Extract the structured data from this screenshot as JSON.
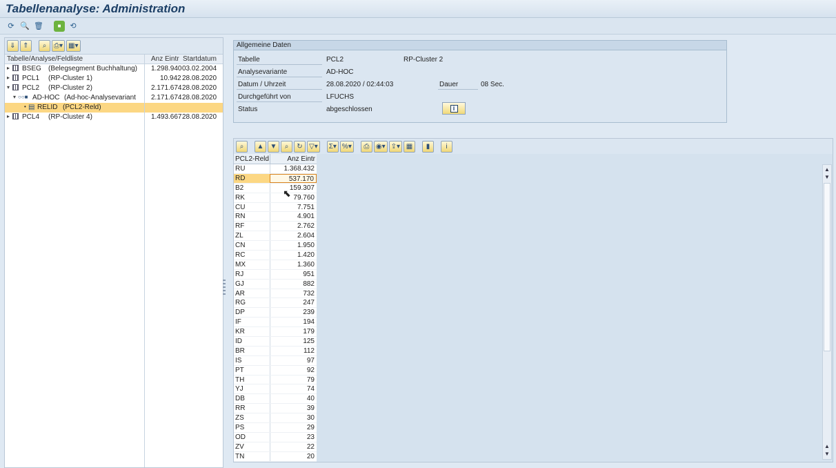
{
  "window": {
    "title": "Tabellenanalyse: Administration"
  },
  "toolbar": {
    "icons": [
      "execute-icon",
      "find-icon",
      "delete-icon",
      "new-icon",
      "refresh-icon"
    ]
  },
  "tree": {
    "columns": {
      "name": "Tabelle/Analyse/Feldliste",
      "count": "Anz Eintr",
      "date": "Startdatum"
    },
    "rows": [
      {
        "name": "BSEG",
        "desc": "(Belegsegment Buchhaltung)",
        "count": "1.298.940",
        "date": "03.02.2004"
      },
      {
        "name": "PCL1",
        "desc": "(RP-Cluster 1)",
        "count": "10.942",
        "date": "28.08.2020"
      },
      {
        "name": "PCL2",
        "desc": "(RP-Cluster 2)",
        "count": "2.171.674",
        "date": "28.08.2020"
      },
      {
        "name": "AD-HOC",
        "desc": "(Ad-hoc-Analysevariant",
        "count": "2.171.674",
        "date": "28.08.2020"
      },
      {
        "name": "RELID",
        "desc": "(PCL2-Reld)",
        "count": "",
        "date": ""
      },
      {
        "name": "PCL4",
        "desc": "(RP-Cluster 4)",
        "count": "1.493.667",
        "date": "28.08.2020"
      }
    ]
  },
  "general": {
    "header": "Allgemeine Daten",
    "tabelle_label": "Tabelle",
    "tabelle_value": "PCL2",
    "tabelle_desc": "RP-Cluster 2",
    "variante_label": "Analysevariante",
    "variante_value": "AD-HOC",
    "datum_label": "Datum / Uhrzeit",
    "datum_value": "28.08.2020 / 02:44:03",
    "dauer_label": "Dauer",
    "dauer_value": "08 Sec.",
    "durch_label": "Durchgeführt von",
    "durch_value": "LFUCHS",
    "status_label": "Status",
    "status_value": "abgeschlossen",
    "info_label": "i"
  },
  "grid": {
    "col_key": "PCL2-Reld",
    "col_count": "Anz Eintr",
    "rows": [
      [
        "RU",
        "1.368.432"
      ],
      [
        "RD",
        "537.170"
      ],
      [
        "B2",
        "159.307"
      ],
      [
        "RK",
        "79.760"
      ],
      [
        "CU",
        "7.751"
      ],
      [
        "RN",
        "4.901"
      ],
      [
        "RF",
        "2.762"
      ],
      [
        "ZL",
        "2.604"
      ],
      [
        "CN",
        "1.950"
      ],
      [
        "RC",
        "1.420"
      ],
      [
        "MX",
        "1.360"
      ],
      [
        "RJ",
        "951"
      ],
      [
        "GJ",
        "882"
      ],
      [
        "AR",
        "732"
      ],
      [
        "RG",
        "247"
      ],
      [
        "DP",
        "239"
      ],
      [
        "IF",
        "194"
      ],
      [
        "KR",
        "179"
      ],
      [
        "ID",
        "125"
      ],
      [
        "BR",
        "112"
      ],
      [
        "IS",
        "97"
      ],
      [
        "PT",
        "92"
      ],
      [
        "TH",
        "79"
      ],
      [
        "YJ",
        "74"
      ],
      [
        "DB",
        "40"
      ],
      [
        "RR",
        "39"
      ],
      [
        "ZS",
        "30"
      ],
      [
        "PS",
        "29"
      ],
      [
        "OD",
        "23"
      ],
      [
        "ZV",
        "22"
      ],
      [
        "TN",
        "20"
      ]
    ]
  }
}
